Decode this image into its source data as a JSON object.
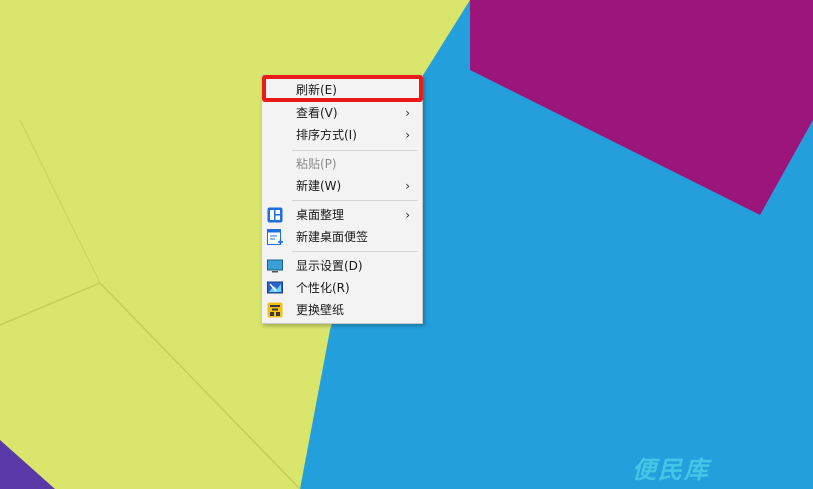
{
  "menu": {
    "items": [
      {
        "label": "刷新(E)",
        "submenu": false,
        "disabled": false,
        "icon": ""
      },
      {
        "label": "查看(V)",
        "submenu": true,
        "disabled": false,
        "icon": ""
      },
      {
        "label": "排序方式(I)",
        "submenu": true,
        "disabled": false,
        "icon": ""
      },
      {
        "label": "粘贴(P)",
        "submenu": false,
        "disabled": true,
        "icon": ""
      },
      {
        "label": "新建(W)",
        "submenu": true,
        "disabled": false,
        "icon": ""
      },
      {
        "label": "桌面整理",
        "submenu": true,
        "disabled": false,
        "icon": "desktop-organize-icon"
      },
      {
        "label": "新建桌面便签",
        "submenu": false,
        "disabled": false,
        "icon": "new-note-icon"
      },
      {
        "label": "显示设置(D)",
        "submenu": false,
        "disabled": false,
        "icon": "display-settings-icon"
      },
      {
        "label": "个性化(R)",
        "submenu": false,
        "disabled": false,
        "icon": "personalize-icon"
      },
      {
        "label": "更换壁纸",
        "submenu": false,
        "disabled": false,
        "icon": "wallpaper-icon"
      }
    ],
    "arrow": "›"
  },
  "watermark": "便民库",
  "colors": {
    "highlight": "#e81a1a",
    "wallpaper_yellow": "#d9e66b",
    "wallpaper_blue": "#23a0dc",
    "wallpaper_purple": "#9c157a",
    "wallpaper_violet": "#5a3aa8",
    "watermark": "#46cbe6"
  }
}
